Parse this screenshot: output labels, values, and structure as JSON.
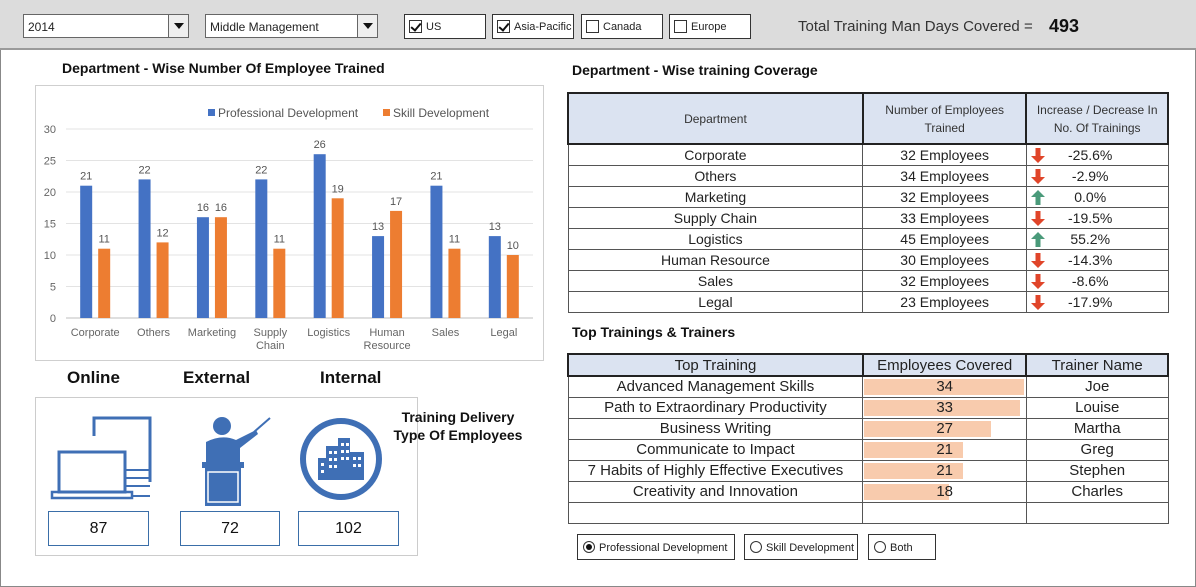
{
  "filters": {
    "year": "2014",
    "level": "Middle Management",
    "regions": [
      {
        "label": "US",
        "checked": true
      },
      {
        "label": "Asia-Pacific",
        "checked": true
      },
      {
        "label": "Canada",
        "checked": false
      },
      {
        "label": "Europe",
        "checked": false
      }
    ]
  },
  "summary": {
    "total_label": "Total Training Man Days Covered =",
    "total_value": "493"
  },
  "chart_section": {
    "title": "Department - Wise Number Of Employee Trained"
  },
  "chart_data": {
    "type": "bar",
    "title": "",
    "categories": [
      "Corporate",
      "Others",
      "Marketing",
      "Supply Chain",
      "Logistics",
      "Human Resource",
      "Sales",
      "Legal"
    ],
    "series": [
      {
        "name": "Professional Development",
        "values": [
          21,
          22,
          16,
          22,
          26,
          13,
          21,
          13
        ],
        "color": "#4472c4"
      },
      {
        "name": "Skill Development",
        "values": [
          11,
          12,
          16,
          11,
          19,
          17,
          11,
          10
        ],
        "color": "#ed7d31"
      }
    ],
    "ylim": [
      0,
      30
    ],
    "yticks": [
      0,
      5,
      10,
      15,
      20,
      25,
      30
    ],
    "grid": true,
    "legend": "top-right",
    "data_labels": true
  },
  "delivery": {
    "caption": "Training Delivery Type Of Employees",
    "items": [
      {
        "label": "Online",
        "value": "87",
        "icon": "laptop-icon"
      },
      {
        "label": "External",
        "value": "72",
        "icon": "presenter-icon"
      },
      {
        "label": "Internal",
        "value": "102",
        "icon": "buildings-icon"
      }
    ]
  },
  "coverage": {
    "title": "Department - Wise training Coverage",
    "headers": [
      "Department",
      "Number of Employees Trained",
      "Increase / Decrease In No. Of Trainings"
    ],
    "rows": [
      {
        "dept": "Corporate",
        "employees": "32 Employees",
        "change": "-25.6%",
        "trend": "down"
      },
      {
        "dept": "Others",
        "employees": "34 Employees",
        "change": "-2.9%",
        "trend": "down"
      },
      {
        "dept": "Marketing",
        "employees": "32 Employees",
        "change": "0.0%",
        "trend": "up"
      },
      {
        "dept": "Supply Chain",
        "employees": "33 Employees",
        "change": "-19.5%",
        "trend": "down"
      },
      {
        "dept": "Logistics",
        "employees": "45 Employees",
        "change": "55.2%",
        "trend": "up"
      },
      {
        "dept": "Human Resource",
        "employees": "30 Employees",
        "change": "-14.3%",
        "trend": "down"
      },
      {
        "dept": "Sales",
        "employees": "32 Employees",
        "change": "-8.6%",
        "trend": "down"
      },
      {
        "dept": "Legal",
        "employees": "23 Employees",
        "change": "-17.9%",
        "trend": "down"
      }
    ],
    "colors": {
      "down": "#e0452a",
      "up": "#4a9a7a"
    }
  },
  "top_trainings": {
    "title": "Top Trainings & Trainers",
    "headers": [
      "Top Training",
      "Employees Covered",
      "Trainer Name"
    ],
    "max_covered": 34,
    "rows": [
      {
        "training": "Advanced Management Skills",
        "covered": 34,
        "trainer": "Joe"
      },
      {
        "training": "Path to Extraordinary Productivity",
        "covered": 33,
        "trainer": "Louise"
      },
      {
        "training": "Business Writing",
        "covered": 27,
        "trainer": "Martha"
      },
      {
        "training": "Communicate to Impact",
        "covered": 21,
        "trainer": "Greg"
      },
      {
        "training": "7 Habits of Highly Effective Executives",
        "covered": 21,
        "trainer": "Stephen"
      },
      {
        "training": "Creativity and Innovation",
        "covered": 18,
        "trainer": "Charles"
      }
    ]
  },
  "view_options": [
    {
      "label": "Professional Development",
      "selected": true
    },
    {
      "label": "Skill Development",
      "selected": false
    },
    {
      "label": "Both",
      "selected": false
    }
  ]
}
